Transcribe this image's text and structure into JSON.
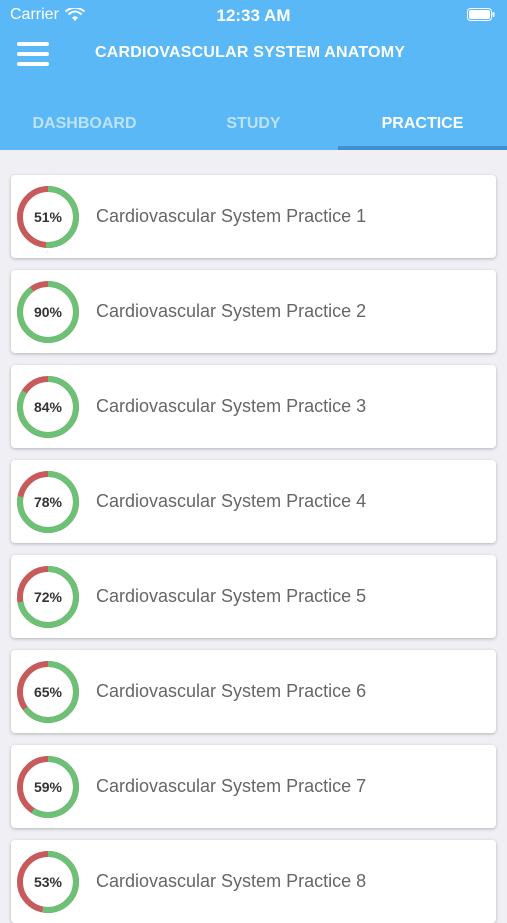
{
  "status_bar": {
    "carrier": "Carrier",
    "time": "12:33 AM"
  },
  "header": {
    "title": "CARDIOVASCULAR SYSTEM ANATOMY",
    "menu_icon": "hamburger-icon"
  },
  "tabs": [
    {
      "label": "DASHBOARD",
      "active": false
    },
    {
      "label": "STUDY",
      "active": false
    },
    {
      "label": "PRACTICE",
      "active": true
    }
  ],
  "colors": {
    "header_bg": "#5ab8f7",
    "ring_correct": "#6cc177",
    "ring_incorrect": "#c75b5b",
    "tab_indicator": "#3d8fd6"
  },
  "practice_items": [
    {
      "title": "Cardiovascular System Practice 1",
      "score_label": "51%",
      "score": 51
    },
    {
      "title": "Cardiovascular System Practice 2",
      "score_label": "90%",
      "score": 90
    },
    {
      "title": "Cardiovascular System Practice 3",
      "score_label": "84%",
      "score": 84
    },
    {
      "title": "Cardiovascular System Practice 4",
      "score_label": "78%",
      "score": 78
    },
    {
      "title": "Cardiovascular System Practice 5",
      "score_label": "72%",
      "score": 72
    },
    {
      "title": "Cardiovascular System Practice 6",
      "score_label": "65%",
      "score": 65
    },
    {
      "title": "Cardiovascular System Practice 7",
      "score_label": "59%",
      "score": 59
    },
    {
      "title": "Cardiovascular System Practice 8",
      "score_label": "53%",
      "score": 53
    }
  ]
}
